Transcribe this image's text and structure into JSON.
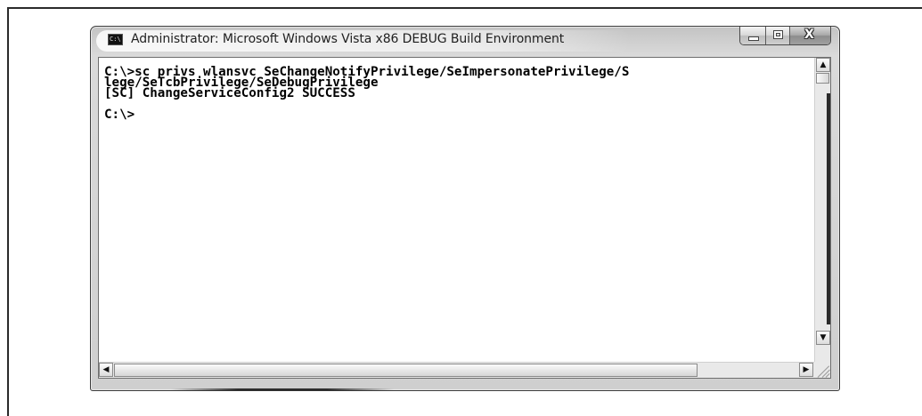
{
  "window": {
    "title": "Administrator: Microsoft Windows Vista x86 DEBUG Build Environment",
    "icon": "console-icon",
    "icon_text": "C:\\",
    "caption_buttons": {
      "minimize": "minimize-icon",
      "maximize": "maximize-icon",
      "close": "close-icon",
      "close_glyph": "X"
    }
  },
  "console": {
    "lines": [
      "C:\\>sc privs wlansvc SeChangeNotifyPrivilege/SeImpersonatePrivilege/S",
      "lege/SeTcbPrivilege/SeDebugPrivilege",
      "[SC] ChangeServiceConfig2 SUCCESS",
      "",
      "C:\\>"
    ]
  },
  "scrollbars": {
    "up_arrow": "▲",
    "down_arrow": "▼",
    "left_arrow": "◀",
    "right_arrow": "▶"
  }
}
